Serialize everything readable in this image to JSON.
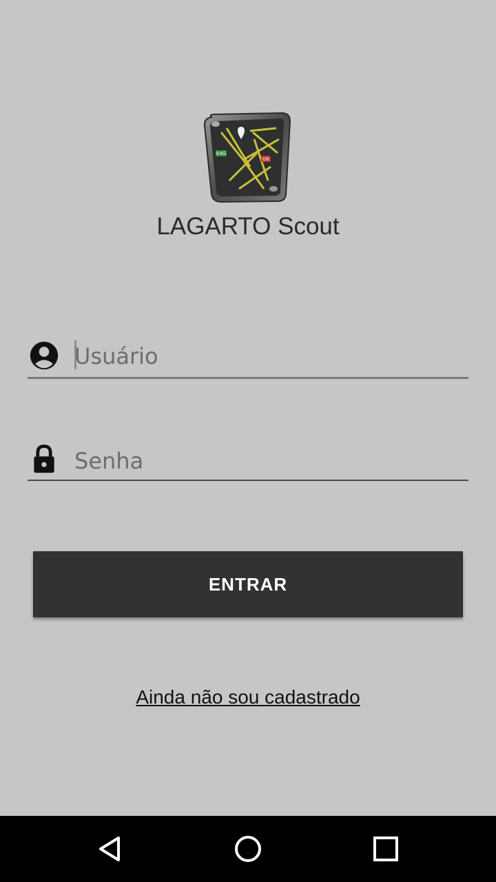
{
  "app": {
    "title": "LAGARTO Scout"
  },
  "logo": {
    "icon": "map-app-icon",
    "badge_left": "E4G",
    "badge_right": "G6"
  },
  "form": {
    "username": {
      "placeholder": "Usuário",
      "value": "",
      "icon": "account-circle-icon"
    },
    "password": {
      "placeholder": "Senha",
      "value": "",
      "icon": "lock-icon"
    },
    "submit_label": "ENTRAR",
    "register_link": "Ainda não sou cadastrado"
  },
  "navbar": {
    "back": "back-icon",
    "home": "home-icon",
    "recents": "recents-icon"
  },
  "colors": {
    "background": "#c6c6c6",
    "button": "#323232",
    "navbar": "#000000"
  }
}
